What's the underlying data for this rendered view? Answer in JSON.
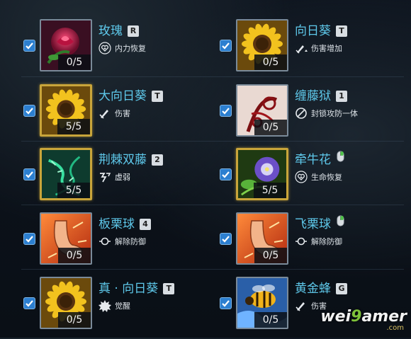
{
  "colors": {
    "name_text": "#5ec8ea",
    "checkbox_fill": "#2c7fd0",
    "gold_frame": "#c9a53a",
    "silver_frame": "#7a8a99"
  },
  "items": [
    {
      "name": "玫瑰",
      "tag": "R",
      "tag_kind": "key",
      "effect": "内力恢复",
      "effect_icon": "heart-plus-icon",
      "count": "0/5",
      "checked": true,
      "art": "rose-art",
      "frame": "silver"
    },
    {
      "name": "向日葵",
      "tag": "T",
      "tag_kind": "key",
      "effect": "伤害增加",
      "effect_icon": "sword-up-icon",
      "count": "0/5",
      "checked": true,
      "art": "sunflower-art",
      "frame": "silver"
    },
    {
      "name": "大向日葵",
      "tag": "T",
      "tag_kind": "key",
      "effect": "伤害",
      "effect_icon": "sword-icon",
      "count": "5/5",
      "checked": true,
      "art": "sunflower-art",
      "frame": "gold"
    },
    {
      "name": "缠藤狱",
      "tag": "1",
      "tag_kind": "key",
      "effect": "封锁攻防一体",
      "effect_icon": "block-icon",
      "count": "0/5",
      "checked": true,
      "art": "vine-art",
      "frame": "silver"
    },
    {
      "name": "荆棘双藤",
      "tag": "2",
      "tag_kind": "key",
      "effect": "虚弱",
      "effect_icon": "weaken-icon",
      "count": "5/5",
      "checked": true,
      "art": "thorn-art",
      "frame": "gold"
    },
    {
      "name": "牵牛花",
      "tag": "",
      "tag_kind": "mouse",
      "effect": "生命恢复",
      "effect_icon": "heart-plus-icon",
      "count": "5/5",
      "checked": true,
      "art": "morning-glory-art",
      "frame": "gold"
    },
    {
      "name": "板栗球",
      "tag": "4",
      "tag_kind": "key",
      "effect": "解除防御",
      "effect_icon": "shield-break-icon",
      "count": "0/5",
      "checked": true,
      "art": "foot-art",
      "frame": "silver"
    },
    {
      "name": "飞栗球",
      "tag": "",
      "tag_kind": "mouse",
      "effect": "解除防御",
      "effect_icon": "shield-break-icon",
      "count": "0/5",
      "checked": true,
      "art": "foot-art",
      "frame": "silver"
    },
    {
      "name": "真 · 向日葵",
      "tag": "T",
      "tag_kind": "key",
      "effect": "觉醒",
      "effect_icon": "awaken-icon",
      "count": "0/5",
      "checked": true,
      "art": "sunflower-art",
      "frame": "silver"
    },
    {
      "name": "黄金蜂",
      "tag": "G",
      "tag_kind": "key",
      "effect": "伤害",
      "effect_icon": "sword-icon",
      "count": "0/5",
      "checked": true,
      "art": "bee-art",
      "frame": "silver"
    }
  ],
  "watermark": {
    "main_a": "wei",
    "main_b": "9",
    "main_c": "amer",
    "sub": ".com"
  }
}
